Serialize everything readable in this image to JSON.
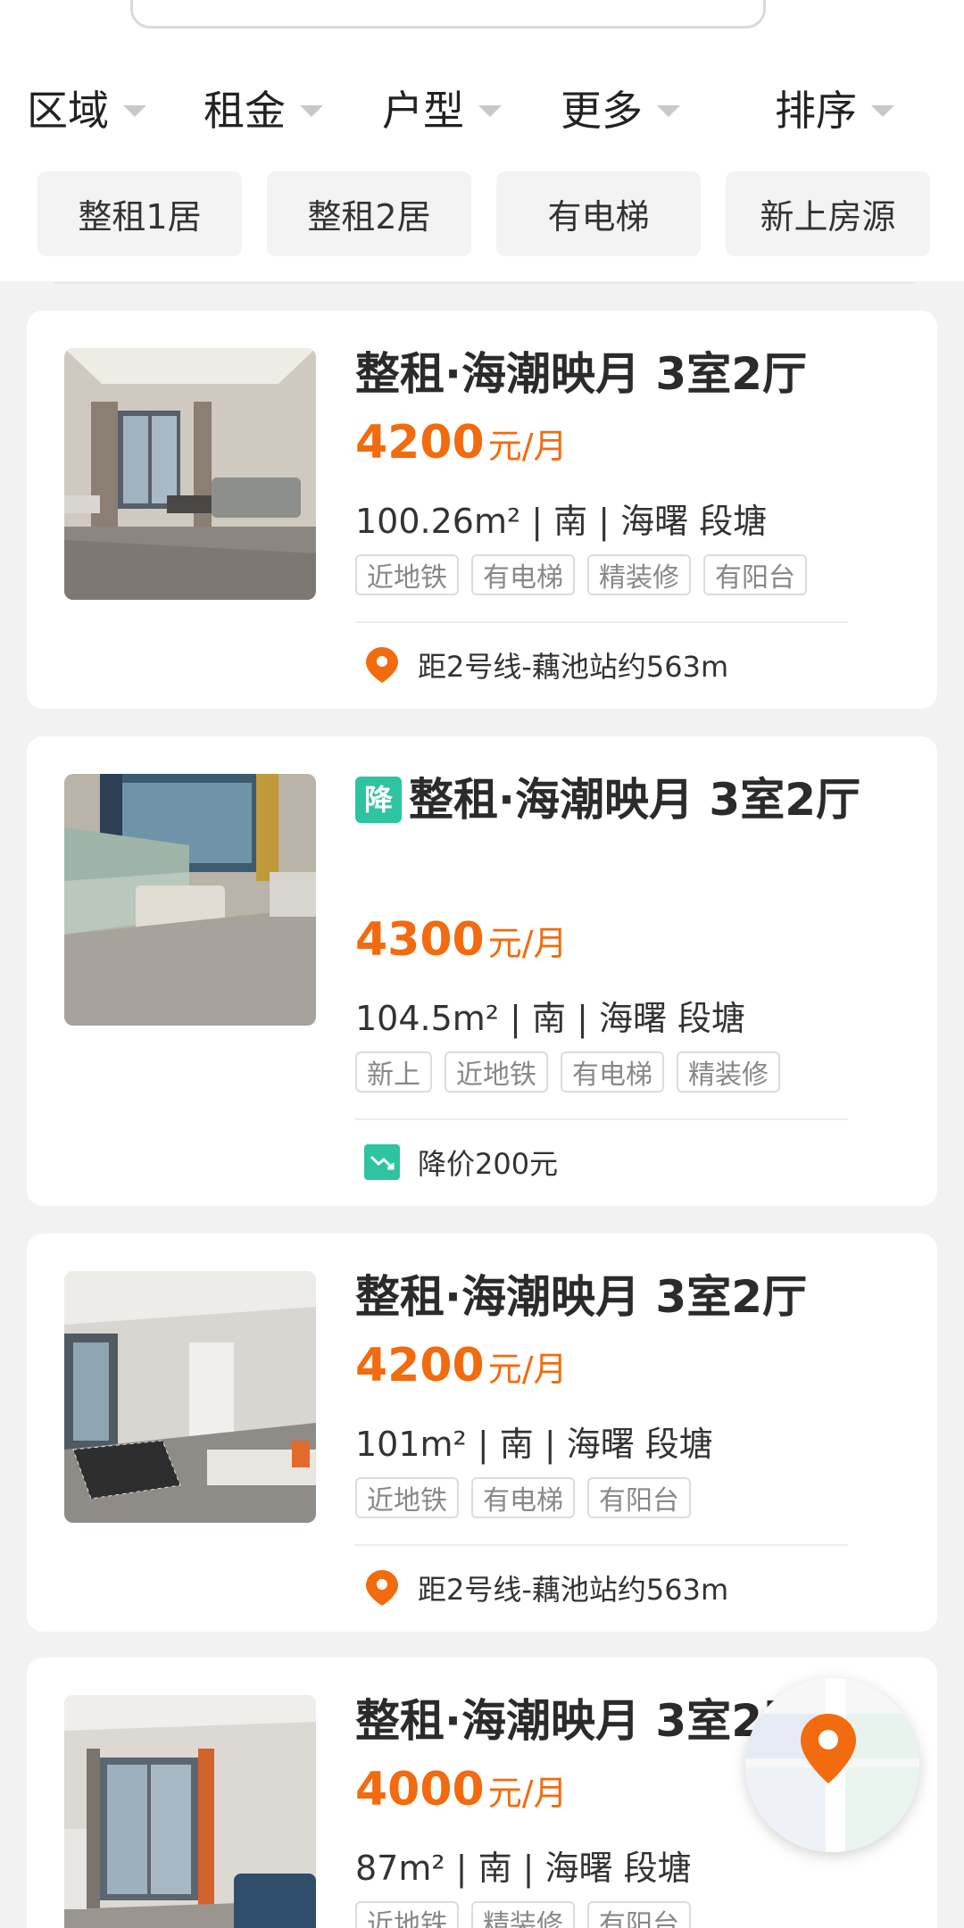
{
  "filters": [
    {
      "label": "区域"
    },
    {
      "label": "租金"
    },
    {
      "label": "户型"
    },
    {
      "label": "更多"
    },
    {
      "label": "排序"
    }
  ],
  "quick_filters": [
    "整租1居",
    "整租2居",
    "有电梯",
    "新上房源"
  ],
  "listings": [
    {
      "title": "整租·海潮映月 3室2厅",
      "price": "4200",
      "price_unit": "元/月",
      "meta": "100.26m² | 南 | 海曙 段塘",
      "tags": [
        "近地铁",
        "有电梯",
        "精装修",
        "有阳台"
      ],
      "bottom_text": "距2号线-藕池站约563m",
      "bottom_icon": "location-pin-icon"
    },
    {
      "badge": "降",
      "title": "整租·海潮映月 3室2厅",
      "price": "4300",
      "price_unit": "元/月",
      "meta": "104.5m² | 南 | 海曙 段塘",
      "tags": [
        "新上",
        "近地铁",
        "有电梯",
        "精装修"
      ],
      "bottom_text": "降价200元",
      "bottom_icon": "price-drop-icon"
    },
    {
      "title": "整租·海潮映月 3室2厅",
      "price": "4200",
      "price_unit": "元/月",
      "meta": "101m² | 南 | 海曙 段塘",
      "tags": [
        "近地铁",
        "有电梯",
        "有阳台"
      ],
      "bottom_text": "距2号线-藕池站约563m",
      "bottom_icon": "location-pin-icon"
    },
    {
      "title": "整租·海潮映月 3室2厅",
      "price": "4000",
      "price_unit": "元/月",
      "meta": "87m² | 南 | 海曙 段塘",
      "tags": [
        "近地铁",
        "精装修",
        "有阳台"
      ]
    }
  ],
  "colors": {
    "price": "#f26b0f",
    "badge": "#2ec4a2",
    "pin": "#f26b0f"
  },
  "map_button": {
    "icon": "map-pin-icon"
  }
}
